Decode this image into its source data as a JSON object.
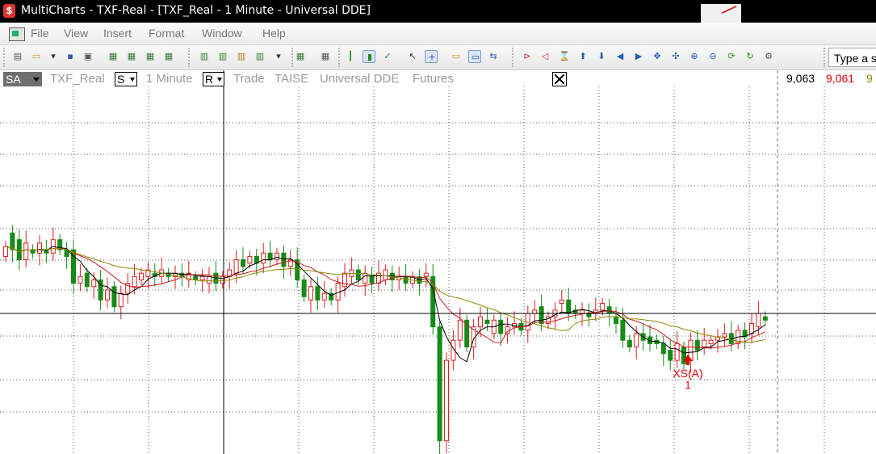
{
  "window": {
    "title": "MultiCharts - TXF-Real - [TXF_Real - 1 Minute - Universal DDE]",
    "app_icon": "multicharts-logo-icon"
  },
  "menu": {
    "items": [
      "File",
      "View",
      "Insert",
      "Format",
      "Window",
      "Help"
    ]
  },
  "toolbar": {
    "search_placeholder": "Type a s",
    "icons": [
      "new-icon",
      "open-icon",
      "open-dropdown-icon",
      "save-icon",
      "print-icon",
      "window-1-icon",
      "window-2-icon",
      "window-3-icon",
      "window-4-icon",
      "chart-icon",
      "quote-icon",
      "scanner-icon",
      "dom-icon",
      "dropdown-icon",
      "portfolio-icon",
      "grid-icon",
      "bar-icon",
      "candle-icon",
      "check-icon",
      "pointer-icon",
      "crosshair-icon",
      "comment-icon",
      "drawing-icon",
      "link-icon",
      "first-bar-icon",
      "prev-bar-icon",
      "zoom-range-icon",
      "up-arrow-icon",
      "down-arrow-icon",
      "scroll-left-icon",
      "scroll-right-icon",
      "scale-icon",
      "cross-icon",
      "zoom-in-icon",
      "zoom-out-icon",
      "refresh-icon",
      "reload-icon",
      "settings-icon"
    ]
  },
  "status": {
    "session_button": "SA",
    "symbol": "TXF_Real",
    "style_dropdown": "S",
    "interval": "1 Minute",
    "range_dropdown": "R",
    "trade_label": "Trade",
    "exchange": "TAISE",
    "datafeed": "Universal DDE",
    "category": "Futures",
    "price_1": "9,063",
    "price_2": "9,061",
    "price_3": "9",
    "colors": {
      "price_1": "#000000",
      "price_2": "#e00000",
      "price_3": "#8a8a00"
    }
  },
  "chart_data": {
    "type": "candlestick",
    "colors": {
      "up": "#d82020",
      "down": "#178a17",
      "ma_fast": "#000000",
      "ma_mid": "#cc1f1f",
      "ma_slow": "#8a8a00"
    },
    "candles": [
      {
        "o": 9079,
        "c": 9082
      },
      {
        "o": 9086,
        "c": 9081
      },
      {
        "o": 9084,
        "c": 9078
      },
      {
        "o": 9078,
        "c": 9083
      },
      {
        "o": 9081,
        "c": 9080
      },
      {
        "o": 9080,
        "c": 9083
      },
      {
        "o": 9081,
        "c": 9080
      },
      {
        "o": 9080,
        "c": 9084
      },
      {
        "o": 9084,
        "c": 9081
      },
      {
        "o": 9081,
        "c": 9079
      },
      {
        "o": 9081,
        "c": 9071
      },
      {
        "o": 9071,
        "c": 9073
      },
      {
        "o": 9074,
        "c": 9070
      },
      {
        "o": 9070,
        "c": 9072
      },
      {
        "o": 9072,
        "c": 9066
      },
      {
        "o": 9066,
        "c": 9069
      },
      {
        "o": 9070,
        "c": 9064
      },
      {
        "o": 9064,
        "c": 9068
      },
      {
        "o": 9068,
        "c": 9071
      },
      {
        "o": 9070,
        "c": 9073
      },
      {
        "o": 9072,
        "c": 9074
      },
      {
        "o": 9073,
        "c": 9075
      },
      {
        "o": 9074,
        "c": 9073
      },
      {
        "o": 9073,
        "c": 9075
      },
      {
        "o": 9074,
        "c": 9073
      },
      {
        "o": 9073,
        "c": 9074
      },
      {
        "o": 9074,
        "c": 9073
      },
      {
        "o": 9072,
        "c": 9074
      },
      {
        "o": 9073,
        "c": 9072
      },
      {
        "o": 9072,
        "c": 9073
      },
      {
        "o": 9071,
        "c": 9073
      },
      {
        "o": 9074,
        "c": 9071
      },
      {
        "o": 9071,
        "c": 9073
      },
      {
        "o": 9073,
        "c": 9075
      },
      {
        "o": 9074,
        "c": 9078
      },
      {
        "o": 9078,
        "c": 9076
      },
      {
        "o": 9077,
        "c": 9079
      },
      {
        "o": 9079,
        "c": 9077
      },
      {
        "o": 9077,
        "c": 9080
      },
      {
        "o": 9080,
        "c": 9078
      },
      {
        "o": 9078,
        "c": 9080
      },
      {
        "o": 9080,
        "c": 9076
      },
      {
        "o": 9076,
        "c": 9078
      },
      {
        "o": 9078,
        "c": 9072
      },
      {
        "o": 9072,
        "c": 9067
      },
      {
        "o": 9066,
        "c": 9070
      },
      {
        "o": 9070,
        "c": 9066
      },
      {
        "o": 9066,
        "c": 9068
      },
      {
        "o": 9068,
        "c": 9066
      },
      {
        "o": 9066,
        "c": 9071
      },
      {
        "o": 9070,
        "c": 9074
      },
      {
        "o": 9073,
        "c": 9075
      },
      {
        "o": 9075,
        "c": 9072
      },
      {
        "o": 9071,
        "c": 9074
      },
      {
        "o": 9073,
        "c": 9071
      },
      {
        "o": 9071,
        "c": 9074
      },
      {
        "o": 9072,
        "c": 9075
      },
      {
        "o": 9074,
        "c": 9072
      },
      {
        "o": 9072,
        "c": 9073
      },
      {
        "o": 9073,
        "c": 9071
      },
      {
        "o": 9071,
        "c": 9073
      },
      {
        "o": 9073,
        "c": 9071
      },
      {
        "o": 9073,
        "c": 9074
      },
      {
        "o": 9073,
        "c": 9058
      },
      {
        "o": 9058,
        "c": 9024
      },
      {
        "o": 9024,
        "c": 9048
      },
      {
        "o": 9048,
        "c": 9054
      },
      {
        "o": 9054,
        "c": 9060
      },
      {
        "o": 9060,
        "c": 9052
      },
      {
        "o": 9052,
        "c": 9058
      },
      {
        "o": 9058,
        "c": 9061
      },
      {
        "o": 9060,
        "c": 9059
      },
      {
        "o": 9056,
        "c": 9060
      },
      {
        "o": 9060,
        "c": 9056
      },
      {
        "o": 9056,
        "c": 9058
      },
      {
        "o": 9058,
        "c": 9059
      },
      {
        "o": 9059,
        "c": 9057
      },
      {
        "o": 9057,
        "c": 9062
      },
      {
        "o": 9062,
        "c": 9063
      },
      {
        "o": 9064,
        "c": 9059
      },
      {
        "o": 9059,
        "c": 9061
      },
      {
        "o": 9061,
        "c": 9063
      },
      {
        "o": 9065,
        "c": 9066
      },
      {
        "o": 9066,
        "c": 9062
      },
      {
        "o": 9063,
        "c": 9062
      },
      {
        "o": 9062,
        "c": 9063
      },
      {
        "o": 9062,
        "c": 9061
      },
      {
        "o": 9062,
        "c": 9063
      },
      {
        "o": 9063,
        "c": 9065
      },
      {
        "o": 9064,
        "c": 9062
      },
      {
        "o": 9061,
        "c": 9059
      },
      {
        "o": 9060,
        "c": 9054
      },
      {
        "o": 9054,
        "c": 9052
      },
      {
        "o": 9052,
        "c": 9056
      },
      {
        "o": 9056,
        "c": 9054
      },
      {
        "o": 9055,
        "c": 9053
      },
      {
        "o": 9054,
        "c": 9053
      },
      {
        "o": 9053,
        "c": 9050
      },
      {
        "o": 9051,
        "c": 9048
      },
      {
        "o": 9048,
        "c": 9053
      },
      {
        "o": 9052,
        "c": 9047
      },
      {
        "o": 9048,
        "c": 9054
      },
      {
        "o": 9054,
        "c": 9051
      },
      {
        "o": 9052,
        "c": 9054
      },
      {
        "o": 9053,
        "c": 9054
      },
      {
        "o": 9054,
        "c": 9055
      },
      {
        "o": 9055,
        "c": 9056
      },
      {
        "o": 9056,
        "c": 9053
      },
      {
        "o": 9053,
        "c": 9057
      },
      {
        "o": 9057,
        "c": 9055
      },
      {
        "o": 9056,
        "c": 9059
      },
      {
        "o": 9058,
        "c": 9062
      },
      {
        "o": 9061,
        "c": 9060
      }
    ],
    "annotations": {
      "label": "XS(A)",
      "quantity": "1"
    }
  }
}
